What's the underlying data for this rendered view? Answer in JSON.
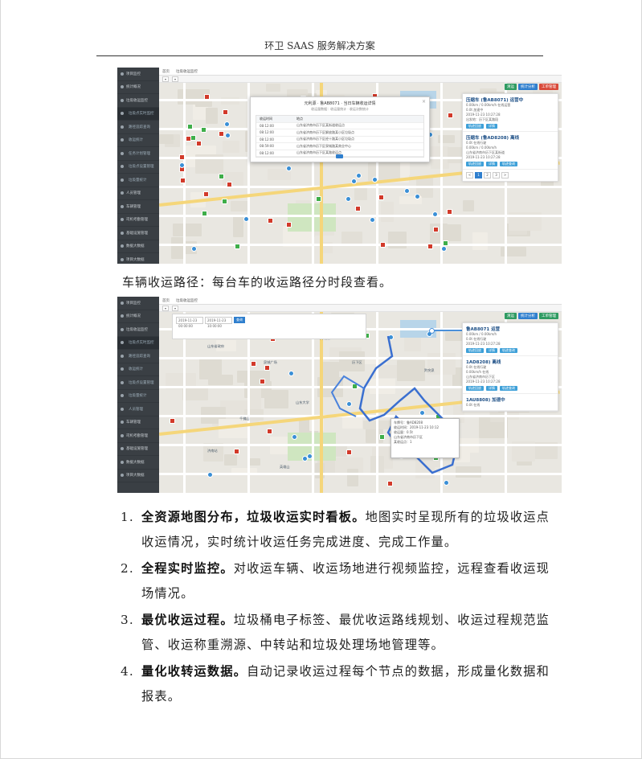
{
  "header": {
    "title": "环卫 SAAS 服务解决方案"
  },
  "screenshot1": {
    "sidebar": [
      "项目监控",
      "统计概况",
      "垃圾收运监控",
      "垃圾点实时监控",
      "路径追踪查询",
      "收运统计",
      "任务计划管理",
      "垃圾点设置管理",
      "垃圾量统计",
      "人员管理",
      "车辆管理",
      "司机考勤管理",
      "基础设施管理",
      "数据大数据",
      "项目大数据"
    ],
    "tabs": [
      "首页",
      "垃圾收运监控"
    ],
    "buttons": [
      "清运",
      "统计分析",
      "工单管理"
    ],
    "modal": {
      "title": "元利源 · 鲁AB8071 · 当日车辆收运详情",
      "subtitle": "收运量数据：收运量统计 · 收运次数统计",
      "headers": [
        "收运时间",
        "地点"
      ],
      "rows": [
        [
          "08:12:00",
          "山东省济南市历下区某街道收运点"
        ],
        [
          "08:12:00",
          "山东省济南市历下区解放路某小区垃圾点"
        ],
        [
          "08:12:00",
          "山东省济南市历下区经十路某小区垃圾点"
        ],
        [
          "08:59:00",
          "山东省济南市历下区泉城路某商业中心"
        ],
        [
          "08:12:00",
          "山东省济南市历下区某路收运点"
        ]
      ]
    },
    "cards": [
      {
        "title": "压缩车 (鲁AB8071) 运营中",
        "lines": [
          "0.00km / 0.00km/h  在线运营",
          "0.0t  加速中",
          "2019-11-23 10:27:28",
          "出发地：历下区某路段"
        ],
        "btns": [
          "轨迹回放",
          "详情"
        ]
      },
      {
        "title": "压缩车 (鲁AD8208) 离线",
        "lines": [
          "0.0t  在线行驶",
          "0.00km / 0.00km/h",
          "山东省济南市历下区某街道",
          "2019-11-23 10:27:28"
        ],
        "btns": [
          "轨迹回放",
          "详情",
          "轨迹查询"
        ]
      }
    ],
    "pager": [
      "<",
      "1",
      "2",
      "3",
      ">"
    ]
  },
  "screenshot2": {
    "sidebar": [
      "项目监控",
      "统计概况",
      "垃圾收运监控",
      "垃圾点实时监控",
      "路径追踪查询",
      "收运统计",
      "垃圾点设置管理",
      "垃圾量统计",
      "人员管理",
      "车辆管理",
      "司机考勤管理",
      "基础设施管理",
      "数据大数据",
      "项目大数据"
    ],
    "tabs": [
      "首页",
      "垃圾收运监控"
    ],
    "buttons": [
      "清运",
      "统计分析",
      "工单管理"
    ],
    "search": {
      "start": "2019-11-23 00:00:00",
      "end": "2019-11-23 10:00:00",
      "go": "查询"
    },
    "info": [
      "车牌号：鲁AD8208",
      "收运时间：2019-11-23 10:12",
      "收运量：0.5t",
      "山东省济南市历下区",
      "某收运点：1"
    ],
    "cards": [
      {
        "title": "鲁AB8071 运营",
        "lines": [
          "0.00km / 0.00km/h",
          "0.0t  在线行驶",
          "2019-11-23 10:27:28"
        ],
        "btns": [
          "轨迹回放",
          "详情",
          "轨迹查询"
        ]
      },
      {
        "title": "1AD8208) 离线",
        "lines": [
          "0.0t  在线行驶",
          "0.00km/h  在线",
          "山东省济南市历下区",
          "2019-11-23 10:27:28"
        ],
        "btns": [
          "轨迹回放",
          "详情",
          "轨迹查询"
        ]
      },
      {
        "title": "1AU8808) 加速中",
        "lines": [
          "0.0t  在线"
        ],
        "btns": []
      }
    ],
    "maplabels": [
      "山东省政府",
      "泉城广场",
      "大明湖",
      "千佛山",
      "山东大学",
      "济南站",
      "历下区",
      "趵突泉",
      "英雄山"
    ]
  },
  "caption": "车辆收运路径：每台车的收运路径分时段查看。",
  "list": [
    {
      "num": "1.",
      "bold": "全资源地图分布，垃圾收运实时看板。",
      "text": "地图实时呈现所有的垃圾收运点收运情况，实时统计收运任务完成进度、完成工作量。"
    },
    {
      "num": "2.",
      "bold": "全程实时监控。",
      "text": "对收运车辆、收运场地进行视频监控，远程查看收运现场情况。"
    },
    {
      "num": "3.",
      "bold": "最优收运过程。",
      "text": "垃圾桶电子标签、最优收运路线规划、收运过程规范监管、收运称重溯源、中转站和垃圾处理场地管理等。"
    },
    {
      "num": "4.",
      "bold": "量化收转运数据。",
      "text": "自动记录收运过程每个节点的数据，形成量化数据和报表。"
    }
  ]
}
